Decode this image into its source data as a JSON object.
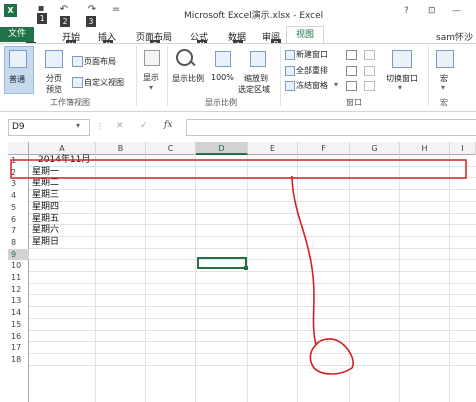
{
  "app": {
    "logo": "X",
    "window_title": "Microsoft Excel演示.xlsx - Excel",
    "help": "?",
    "restore": "⊡",
    "minimize": "—",
    "user": "sam怀沙 ·"
  },
  "qat_keytips": [
    "1",
    "2",
    "3"
  ],
  "tabs": [
    {
      "label": "文件",
      "keytip": "F"
    },
    {
      "label": "开始",
      "keytip": "H"
    },
    {
      "label": "插入",
      "keytip": "N"
    },
    {
      "label": "页面布局",
      "keytip": "P"
    },
    {
      "label": "公式",
      "keytip": "M"
    },
    {
      "label": "数据",
      "keytip": "A"
    },
    {
      "label": "审阅",
      "keytip": "R"
    },
    {
      "label": "视图",
      "keytip": ""
    }
  ],
  "ribbon": {
    "workbook_views": {
      "label": "工作簿视图",
      "normal": "普通",
      "page_break_1": "分页",
      "page_break_2": "预览",
      "page_layout": "页面布局",
      "custom_views": "自定义视图"
    },
    "show": {
      "label": "显示"
    },
    "zoom": {
      "label": "显示比例",
      "zoom": "显示比例",
      "hundred": "100%",
      "zoom_to_sel_1": "缩放到",
      "zoom_to_sel_2": "选定区域"
    },
    "window": {
      "label": "窗口",
      "new_window": "新建窗口",
      "arrange_all": "全部重排",
      "freeze_panes": "冻结窗格",
      "switch_windows": "切换窗口"
    },
    "macros": {
      "label": "宏",
      "macros": "宏"
    }
  },
  "formula_bar": {
    "name_box": "D9",
    "cancel": "✕",
    "enter": "✓",
    "fx": "fx"
  },
  "columns": [
    "A",
    "B",
    "C",
    "D",
    "E",
    "F",
    "G",
    "H",
    "I"
  ],
  "rows": [
    "1",
    "2",
    "3",
    "4",
    "5",
    "6",
    "7",
    "8",
    "9",
    "10",
    "11",
    "12",
    "13",
    "14",
    "15",
    "16",
    "17",
    "18"
  ],
  "cells": {
    "A1": "2014年11月",
    "A2": "星期一",
    "A3": "星期二",
    "A4": "星期三",
    "A5": "星期四",
    "A6": "星期五",
    "A7": "星期六",
    "A8": "星期日"
  },
  "colors": {
    "excel_green": "#217346",
    "annotation_red": "#d62020",
    "selection_green": "#217346"
  }
}
